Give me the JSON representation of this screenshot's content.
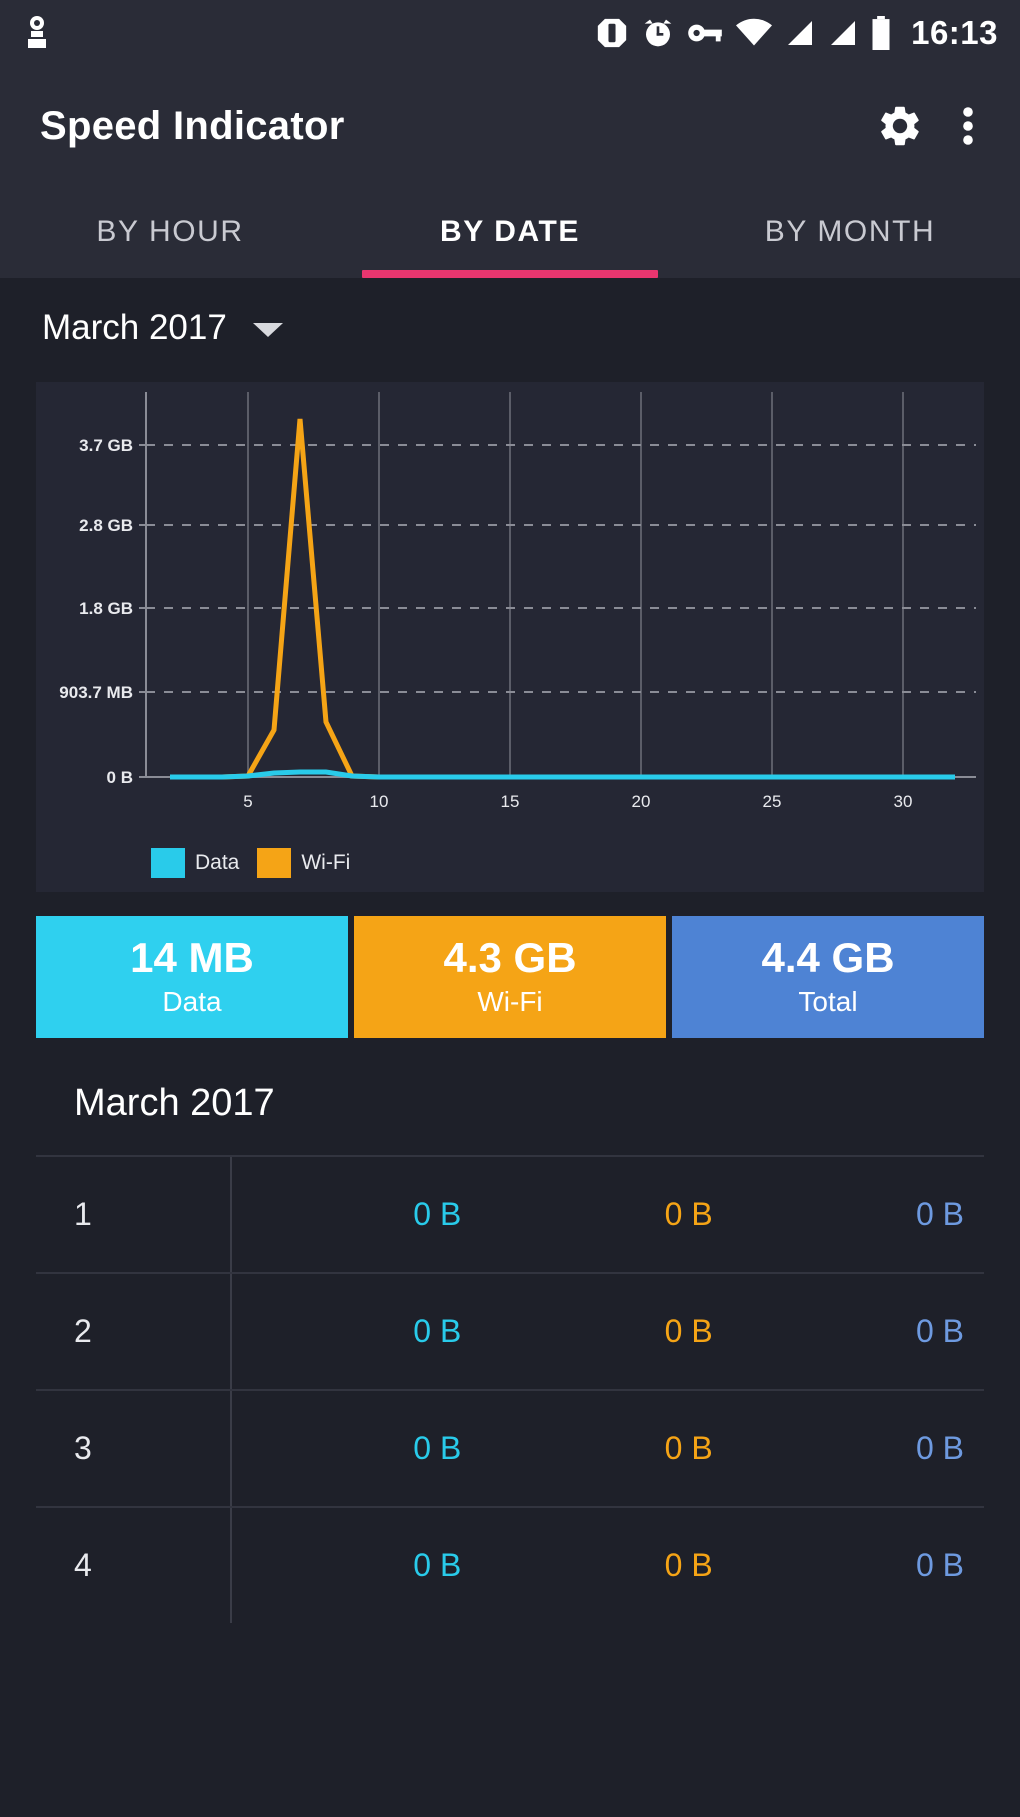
{
  "statusbar": {
    "time": "16:13",
    "icons": [
      {
        "name": "app-notification-icon"
      },
      {
        "name": "do-not-disturb-icon"
      },
      {
        "name": "alarm-icon"
      },
      {
        "name": "vpn-key-icon"
      },
      {
        "name": "wifi-icon"
      },
      {
        "name": "signal-sim1-icon"
      },
      {
        "name": "signal-sim2-icon"
      },
      {
        "name": "battery-icon"
      }
    ]
  },
  "appbar": {
    "title": "Speed Indicator",
    "settings_label": "gear-icon",
    "overflow_label": "more-vert-icon"
  },
  "tabs": [
    {
      "label": "BY HOUR",
      "active": false
    },
    {
      "label": "BY DATE",
      "active": true
    },
    {
      "label": "BY MONTH",
      "active": false
    }
  ],
  "month_selector": {
    "value": "March 2017"
  },
  "chart_data": {
    "type": "line",
    "title": "",
    "xlabel": "",
    "ylabel": "",
    "grid": true,
    "legend_position": "bottom-left",
    "x": [
      1,
      2,
      3,
      4,
      5,
      6,
      7,
      8,
      9,
      10,
      11,
      12,
      13,
      14,
      15,
      16,
      17,
      18,
      19,
      20,
      21,
      22,
      23,
      24,
      25,
      26,
      27,
      28,
      29,
      30,
      31
    ],
    "xticks": [
      "5",
      "10",
      "15",
      "20",
      "25",
      "30"
    ],
    "xtick_values": [
      5,
      10,
      15,
      20,
      25,
      30
    ],
    "yticks": [
      "0 B",
      "903.7 MB",
      "1.8 GB",
      "2.8 GB",
      "3.7 GB"
    ],
    "ytick_values": [
      0,
      0.903,
      1.8,
      2.8,
      3.7
    ],
    "ylim": [
      0,
      4.0
    ],
    "yunit": "GB",
    "series": [
      {
        "name": "Data",
        "color": "#29cbea",
        "values": [
          0,
          0,
          0,
          0,
          0.01,
          0.012,
          0.012,
          0,
          0,
          0,
          0,
          0,
          0,
          0,
          0,
          0,
          0,
          0,
          0,
          0,
          0,
          0,
          0,
          0,
          0,
          0,
          0,
          0,
          0,
          0,
          0
        ]
      },
      {
        "name": "Wi-Fi",
        "color": "#f5a416",
        "values": [
          0,
          0,
          0,
          0,
          0.45,
          3.85,
          0.52,
          0,
          0,
          0,
          0,
          0,
          0,
          0,
          0,
          0,
          0,
          0,
          0,
          0,
          0,
          0,
          0,
          0,
          0,
          0,
          0,
          0,
          0,
          0,
          0
        ]
      }
    ],
    "legend": [
      {
        "label": "Data",
        "color": "#29cbea"
      },
      {
        "label": "Wi-Fi",
        "color": "#f5a416"
      }
    ]
  },
  "summary": [
    {
      "value": "14 MB",
      "label": "Data",
      "color": "#2fd0ef"
    },
    {
      "value": "4.3 GB",
      "label": "Wi-Fi",
      "color": "#f5a416"
    },
    {
      "value": "4.4 GB",
      "label": "Total",
      "color": "#4e83d4"
    }
  ],
  "table": {
    "title": "March 2017",
    "rows": [
      {
        "day": "1",
        "data": "0 B",
        "wifi": "0 B",
        "total": "0 B"
      },
      {
        "day": "2",
        "data": "0 B",
        "wifi": "0 B",
        "total": "0 B"
      },
      {
        "day": "3",
        "data": "0 B",
        "wifi": "0 B",
        "total": "0 B"
      },
      {
        "day": "4",
        "data": "0 B",
        "wifi": "0 B",
        "total": "0 B"
      }
    ]
  },
  "colors": {
    "background": "#1e2029",
    "surface": "#2a2c37",
    "card": "#252734",
    "accent": "#e8366f",
    "data": "#29cbea",
    "wifi": "#f5a416",
    "total": "#6e9ae0"
  }
}
